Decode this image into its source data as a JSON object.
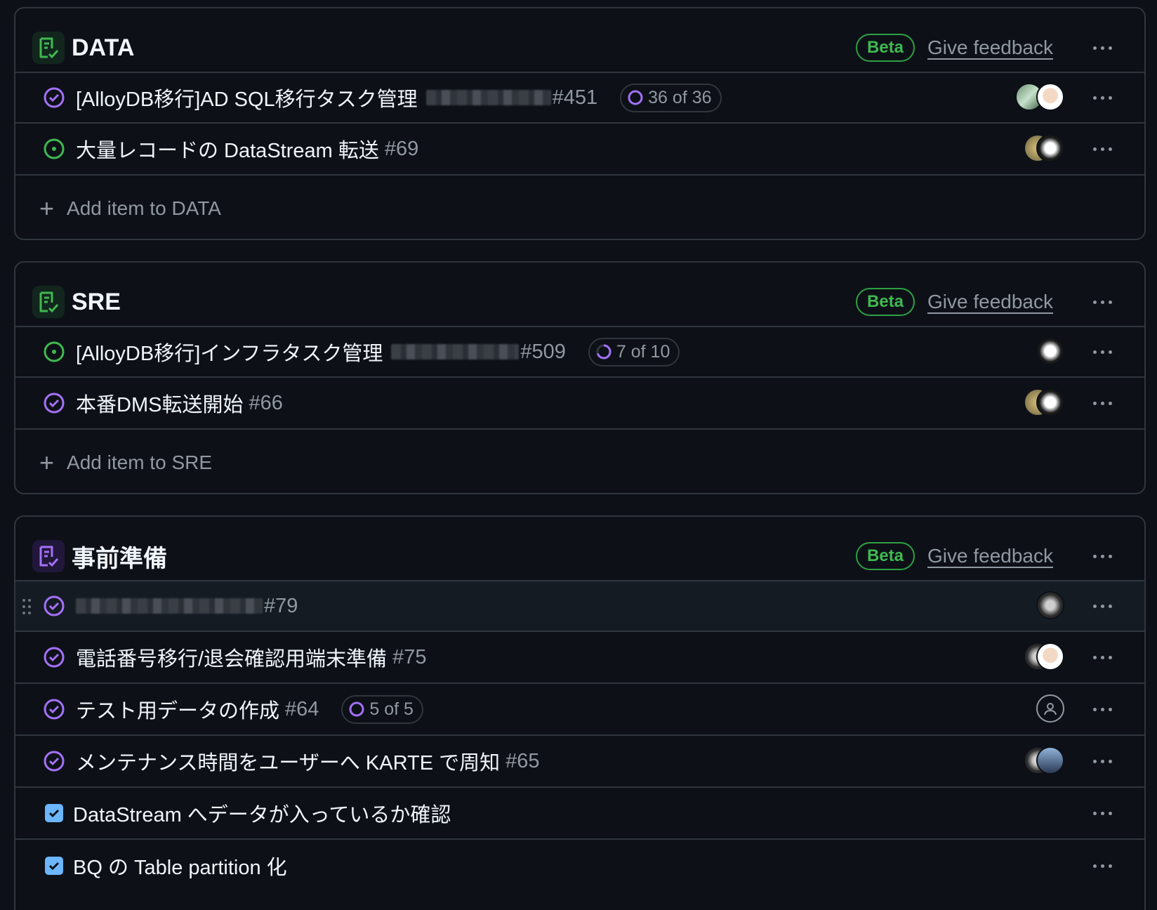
{
  "sections": [
    {
      "title": "DATA",
      "beta": "Beta",
      "feedback": "Give feedback",
      "add": "Add item to DATA",
      "items": [
        {
          "title": "[AlloyDB移行]AD SQL移行タスク管理",
          "number": "#451",
          "progress": "36 of 36"
        },
        {
          "title": "大量レコードの DataStream 転送",
          "number": "#69"
        }
      ]
    },
    {
      "title": "SRE",
      "beta": "Beta",
      "feedback": "Give feedback",
      "add": "Add item to SRE",
      "items": [
        {
          "title": "[AlloyDB移行]インフラタスク管理",
          "number": "#509",
          "progress": "7 of 10"
        },
        {
          "title": "本番DMS転送開始",
          "number": "#66"
        }
      ]
    },
    {
      "title": "事前準備",
      "beta": "Beta",
      "feedback": "Give feedback",
      "items": [
        {
          "title": "",
          "number": "#79"
        },
        {
          "title": "電話番号移行/退会確認用端末準備",
          "number": "#75"
        },
        {
          "title": "テスト用データの作成",
          "number": "#64",
          "progress": "5 of 5"
        },
        {
          "title": "メンテナンス時間をユーザーへ KARTE で周知",
          "number": "#65"
        },
        {
          "title": "DataStream へデータが入っているか確認"
        },
        {
          "title": "BQ の Table partition 化"
        }
      ]
    }
  ],
  "colors": {
    "closed": "#a371f7",
    "open": "#3fb950",
    "beta": "#3fb950",
    "border": "#30363d",
    "checkbox": "#6cb6ff"
  }
}
